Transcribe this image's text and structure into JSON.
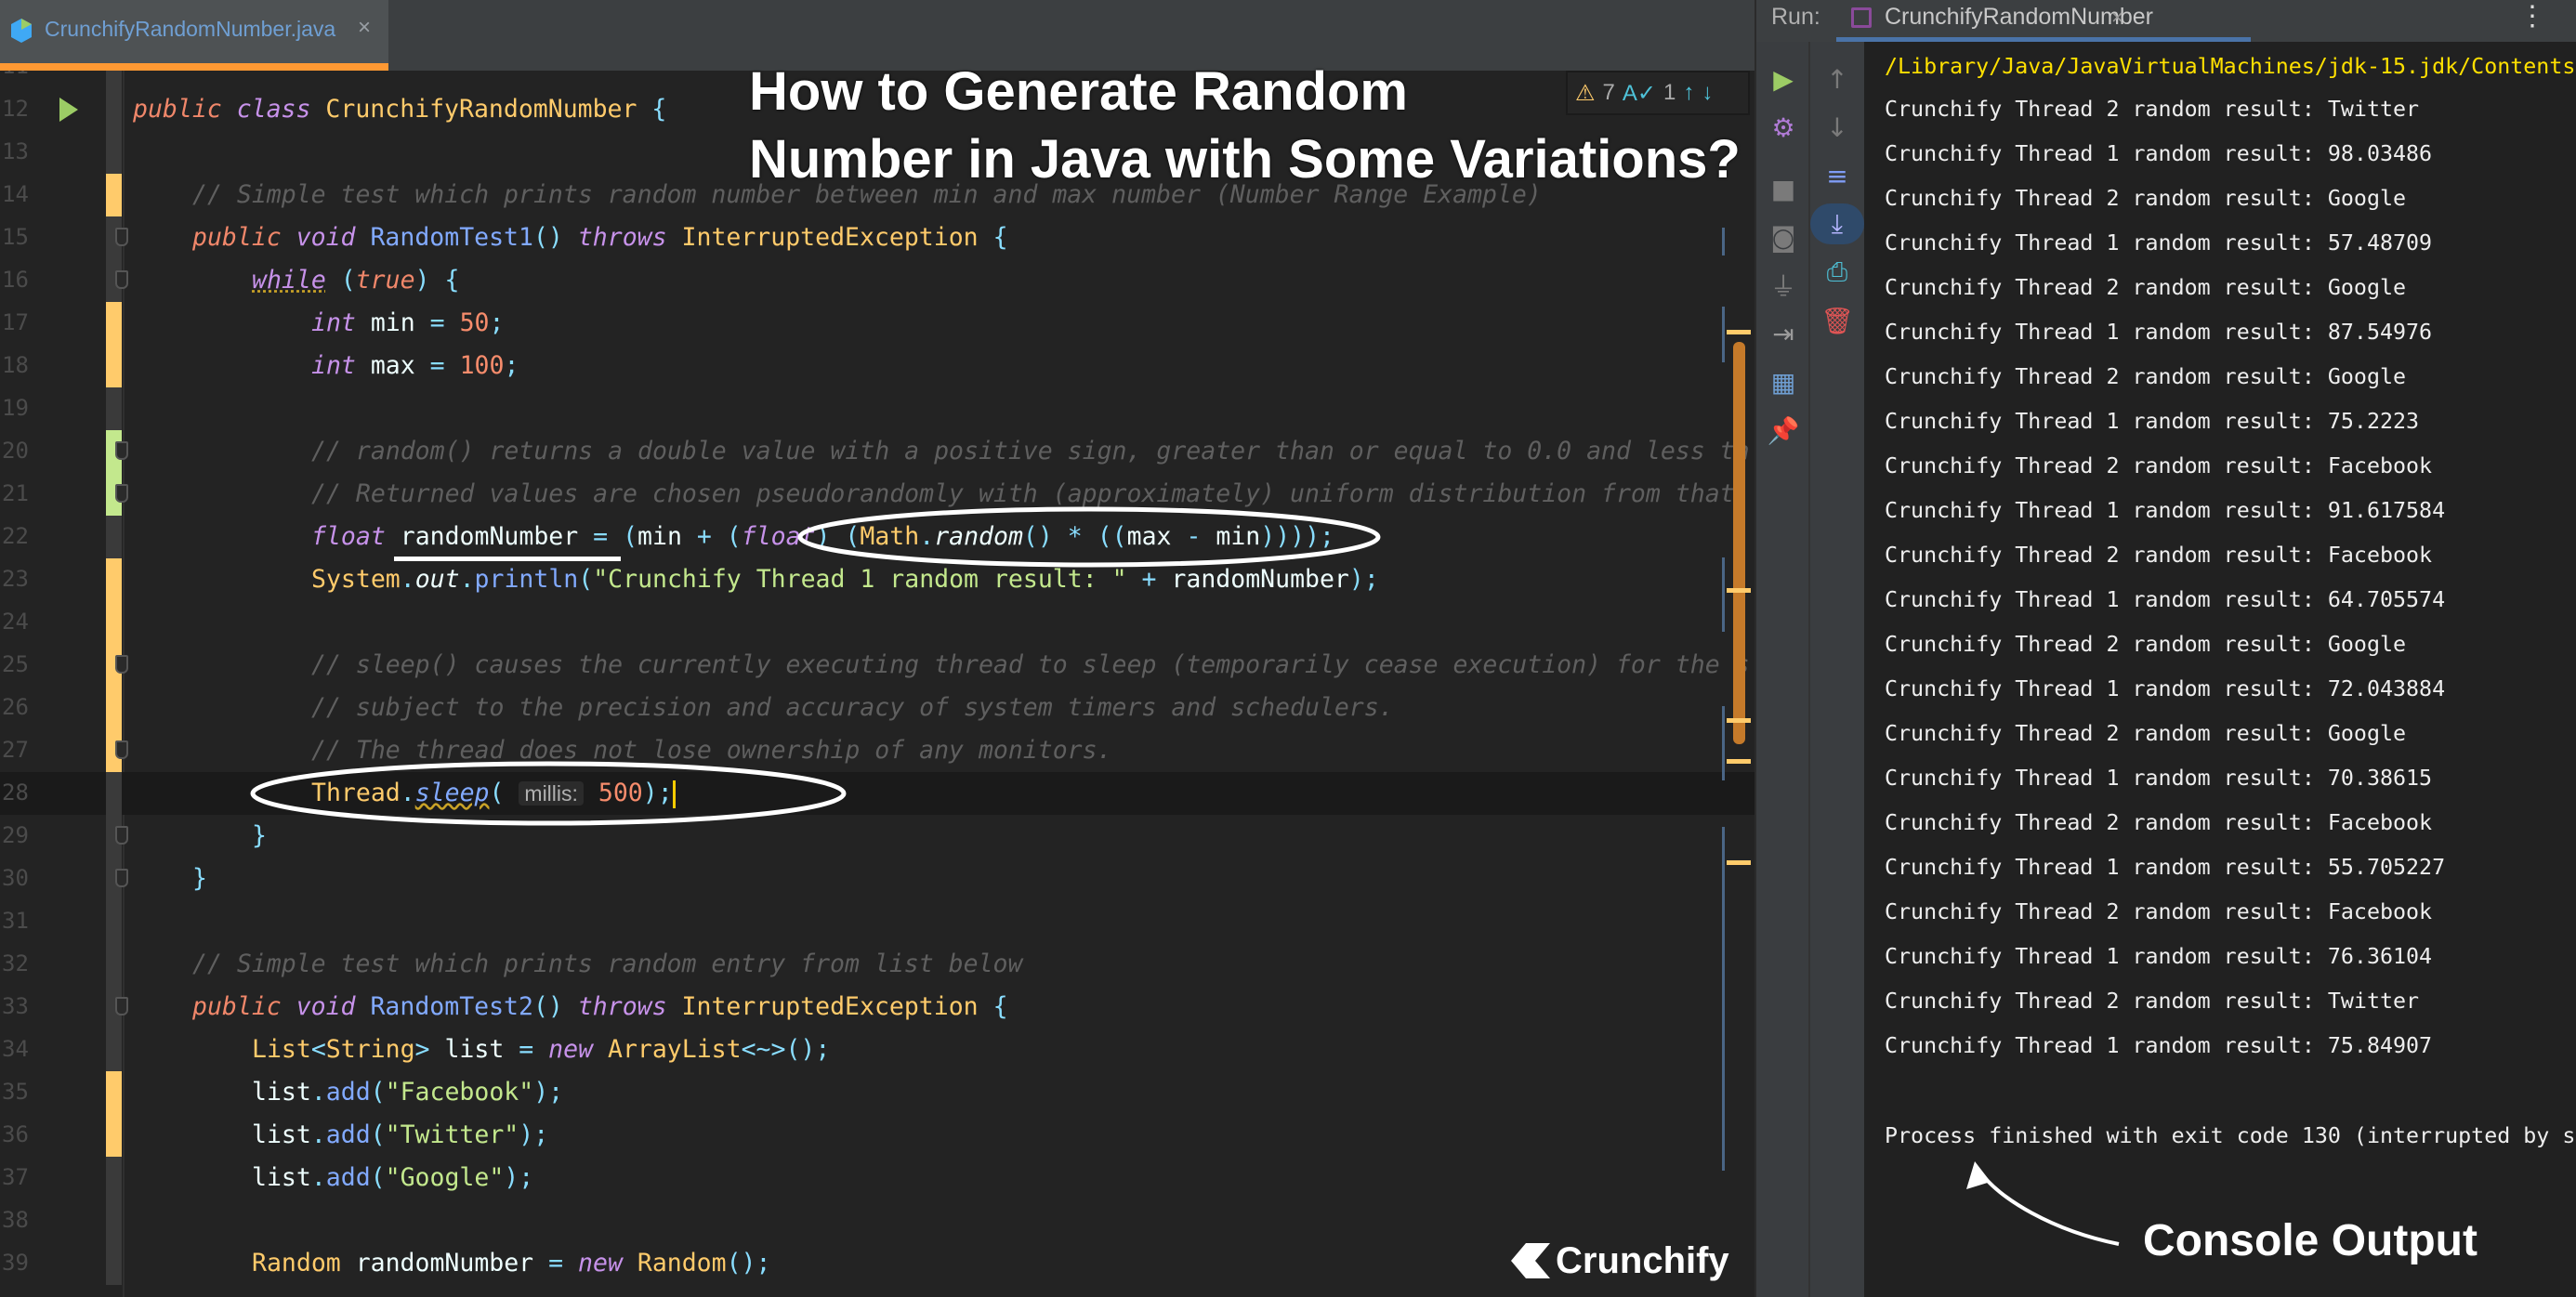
{
  "editor_tab": {
    "filename": "CrunchifyRandomNumber.java",
    "close": "×",
    "icon": "java-class-icon"
  },
  "overlay_title": {
    "line1": "How to Generate Random",
    "line2": "Number in Java with Some Variations?"
  },
  "inspection": {
    "warnings": "7",
    "typos": "1",
    "warn_icon": "⚠",
    "typo_icon": "A✓",
    "up": "↑",
    "down": "↓"
  },
  "editor": {
    "current_line": 28,
    "lines": [
      {
        "n": "11",
        "indent": 0,
        "change": "none",
        "tokens": []
      },
      {
        "n": "12",
        "indent": 0,
        "change": "none",
        "run": true,
        "tokens": [
          [
            "public ",
            "pub"
          ],
          [
            "class ",
            "kw"
          ],
          [
            "CrunchifyRandomNumber ",
            "cls"
          ],
          [
            "{",
            "p"
          ]
        ]
      },
      {
        "n": "13",
        "indent": 0,
        "change": "none",
        "tokens": []
      },
      {
        "n": "14",
        "indent": 1,
        "change": "modified",
        "tokens": [
          [
            "// Simple test which prints random number between min and max number (Number Range Example)",
            "cm"
          ]
        ]
      },
      {
        "n": "15",
        "indent": 1,
        "change": "none",
        "fold": true,
        "tokens": [
          [
            "public ",
            "pub"
          ],
          [
            "void ",
            "kw"
          ],
          [
            "RandomTest1",
            "fn"
          ],
          [
            "() ",
            "p"
          ],
          [
            "throws ",
            "kw"
          ],
          [
            "InterruptedException ",
            "cls"
          ],
          [
            "{",
            "p"
          ]
        ]
      },
      {
        "n": "16",
        "indent": 2,
        "change": "none",
        "fold": true,
        "tokens": [
          [
            "while",
            "kwu"
          ],
          [
            " (",
            "p"
          ],
          [
            "true",
            "pub"
          ],
          [
            ") {",
            "p"
          ]
        ]
      },
      {
        "n": "17",
        "indent": 3,
        "change": "modified",
        "tokens": [
          [
            "int ",
            "kw"
          ],
          [
            "min ",
            "id"
          ],
          [
            "= ",
            "p"
          ],
          [
            "50",
            "num"
          ],
          [
            ";",
            "p"
          ]
        ]
      },
      {
        "n": "18",
        "indent": 3,
        "change": "modified",
        "tokens": [
          [
            "int ",
            "kw"
          ],
          [
            "max ",
            "id"
          ],
          [
            "= ",
            "p"
          ],
          [
            "100",
            "num"
          ],
          [
            ";",
            "p"
          ]
        ]
      },
      {
        "n": "19",
        "indent": 0,
        "change": "none",
        "tokens": []
      },
      {
        "n": "20",
        "indent": 3,
        "change": "added",
        "fold": true,
        "tokens": [
          [
            "// random() returns a double value with a positive sign, greater than or equal to 0.0 and less th",
            "cm"
          ]
        ]
      },
      {
        "n": "21",
        "indent": 3,
        "change": "added",
        "fold": true,
        "tokens": [
          [
            "// Returned values are chosen pseudorandomly with (approximately) uniform distribution from that",
            "cm"
          ]
        ]
      },
      {
        "n": "22",
        "indent": 3,
        "change": "none",
        "tokens": [
          [
            "float ",
            "kw"
          ],
          [
            "randomNumber ",
            "id"
          ],
          [
            "= (",
            "p"
          ],
          [
            "min ",
            "id"
          ],
          [
            "+ (",
            "p"
          ],
          [
            "float",
            "kw"
          ],
          [
            ") (",
            "p"
          ],
          [
            "Math",
            "cls"
          ],
          [
            ".",
            "p"
          ],
          [
            "random",
            "fni0"
          ],
          [
            "() * ((",
            "p"
          ],
          [
            "max ",
            "id"
          ],
          [
            "- ",
            "p"
          ],
          [
            "min",
            "id"
          ],
          [
            "))));",
            "p"
          ]
        ]
      },
      {
        "n": "23",
        "indent": 3,
        "change": "modified",
        "tokens": [
          [
            "System",
            "cls"
          ],
          [
            ".",
            "p"
          ],
          [
            "out",
            "it"
          ],
          [
            ".",
            "p"
          ],
          [
            "println",
            "fn"
          ],
          [
            "(",
            "p"
          ],
          [
            "\"Crunchify Thread 1 random result: \" ",
            "str"
          ],
          [
            "+ ",
            "p"
          ],
          [
            "randomNumber",
            "id"
          ],
          [
            ");",
            "p"
          ]
        ]
      },
      {
        "n": "24",
        "indent": 0,
        "change": "modified",
        "tokens": []
      },
      {
        "n": "25",
        "indent": 3,
        "change": "modified",
        "fold": true,
        "tokens": [
          [
            "// sleep() causes the currently executing thread to sleep (temporarily cease execution) for the s",
            "cm"
          ]
        ]
      },
      {
        "n": "26",
        "indent": 3,
        "change": "modified",
        "tokens": [
          [
            "// subject to the precision and accuracy of system timers and schedulers.",
            "cm"
          ]
        ]
      },
      {
        "n": "27",
        "indent": 3,
        "change": "modified",
        "fold": true,
        "tokens": [
          [
            "// The thread does not lose ownership of any monitors.",
            "cm"
          ]
        ]
      },
      {
        "n": "28",
        "indent": 3,
        "change": "none",
        "tokens": [
          [
            "Thread",
            "cls"
          ],
          [
            ".",
            "p"
          ],
          [
            "sleep",
            "fni"
          ],
          [
            "( ",
            "p"
          ],
          [
            "millis:",
            "hint"
          ],
          [
            " ",
            "p"
          ],
          [
            "500",
            "num"
          ],
          [
            ");",
            "p"
          ]
        ],
        "caret": true
      },
      {
        "n": "29",
        "indent": 2,
        "change": "none",
        "fold": true,
        "tokens": [
          [
            "}",
            "p"
          ]
        ]
      },
      {
        "n": "30",
        "indent": 1,
        "change": "none",
        "fold": true,
        "tokens": [
          [
            "}",
            "p"
          ]
        ]
      },
      {
        "n": "31",
        "indent": 0,
        "change": "none",
        "tokens": []
      },
      {
        "n": "32",
        "indent": 1,
        "change": "none",
        "tokens": [
          [
            "// Simple test which prints random entry from list below",
            "cm"
          ]
        ]
      },
      {
        "n": "33",
        "indent": 1,
        "change": "none",
        "fold": true,
        "tokens": [
          [
            "public ",
            "pub"
          ],
          [
            "void ",
            "kw"
          ],
          [
            "RandomTest2",
            "fn"
          ],
          [
            "() ",
            "p"
          ],
          [
            "throws ",
            "kw"
          ],
          [
            "InterruptedException ",
            "cls"
          ],
          [
            "{",
            "p"
          ]
        ]
      },
      {
        "n": "34",
        "indent": 2,
        "change": "none",
        "tokens": [
          [
            "List",
            "cls"
          ],
          [
            "<",
            "p"
          ],
          [
            "String",
            "cls"
          ],
          [
            "> ",
            "p"
          ],
          [
            "list ",
            "id"
          ],
          [
            "= ",
            "p"
          ],
          [
            "new ",
            "kw"
          ],
          [
            "ArrayList",
            "cls"
          ],
          [
            "<~>();",
            "p"
          ]
        ]
      },
      {
        "n": "35",
        "indent": 2,
        "change": "modified",
        "tokens": [
          [
            "list",
            "id"
          ],
          [
            ".",
            "p"
          ],
          [
            "add",
            "fn"
          ],
          [
            "(",
            "p"
          ],
          [
            "\"Facebook\"",
            "str"
          ],
          [
            ");",
            "p"
          ]
        ]
      },
      {
        "n": "36",
        "indent": 2,
        "change": "modified",
        "tokens": [
          [
            "list",
            "id"
          ],
          [
            ".",
            "p"
          ],
          [
            "add",
            "fn"
          ],
          [
            "(",
            "p"
          ],
          [
            "\"Twitter\"",
            "str"
          ],
          [
            ");",
            "p"
          ]
        ]
      },
      {
        "n": "37",
        "indent": 2,
        "change": "none",
        "tokens": [
          [
            "list",
            "id"
          ],
          [
            ".",
            "p"
          ],
          [
            "add",
            "fn"
          ],
          [
            "(",
            "p"
          ],
          [
            "\"Google\"",
            "str"
          ],
          [
            ");",
            "p"
          ]
        ]
      },
      {
        "n": "38",
        "indent": 0,
        "change": "none",
        "tokens": []
      },
      {
        "n": "39",
        "indent": 2,
        "change": "none",
        "tokens": [
          [
            "Random ",
            "cls"
          ],
          [
            "randomNumber ",
            "id"
          ],
          [
            "= ",
            "p"
          ],
          [
            "new ",
            "kw"
          ],
          [
            "Random",
            "cls"
          ],
          [
            "();",
            "p"
          ]
        ]
      }
    ]
  },
  "logo": {
    "text": "Crunchify"
  },
  "run_panel": {
    "label": "Run:",
    "tab": "CrunchifyRandomNumber",
    "close": "×",
    "more": "⋮",
    "toolbar_left": [
      {
        "icon": "rerun-icon",
        "glyph": "▶",
        "color": "#9ccc65"
      },
      {
        "icon": "settings-icon",
        "glyph": "⚙",
        "color": "#b07bd6"
      },
      {
        "icon": "stop-icon",
        "glyph": "■",
        "color": "#7a7a7a"
      },
      {
        "icon": "camera-icon",
        "glyph": "◙",
        "color": "#7a7a7a"
      },
      {
        "icon": "plug-icon",
        "glyph": "⏚",
        "color": "#7a7a7a"
      },
      {
        "icon": "exit-icon",
        "glyph": "⇥",
        "color": "#9a9a9a"
      },
      {
        "icon": "layout-icon",
        "glyph": "▦",
        "color": "#6f9fd3"
      },
      {
        "icon": "pin-icon",
        "glyph": "📌",
        "color": "#b07bd6"
      }
    ],
    "toolbar_right": [
      {
        "icon": "up-icon",
        "glyph": "↑",
        "color": "#7a7a7a"
      },
      {
        "icon": "down-icon",
        "glyph": "↓",
        "color": "#7a7a7a"
      },
      {
        "icon": "soft-wrap-icon",
        "glyph": "≡",
        "color": "#7f9cf5"
      },
      {
        "icon": "scroll-to-end-icon",
        "glyph": "⤓",
        "color": "#b6b6ff"
      },
      {
        "icon": "print-icon",
        "glyph": "⎙",
        "color": "#4ec2d8"
      },
      {
        "icon": "trash-icon",
        "glyph": "🗑",
        "color": "#e05555"
      }
    ],
    "console": {
      "path": "/Library/Java/JavaVirtualMachines/jdk-15.jdk/Contents",
      "lines": [
        "Crunchify Thread 2 random result: Twitter",
        "Crunchify Thread 1 random result: 98.03486",
        "Crunchify Thread 2 random result: Google",
        "Crunchify Thread 1 random result: 57.48709",
        "Crunchify Thread 2 random result: Google",
        "Crunchify Thread 1 random result: 87.54976",
        "Crunchify Thread 2 random result: Google",
        "Crunchify Thread 1 random result: 75.2223",
        "Crunchify Thread 2 random result: Facebook",
        "Crunchify Thread 1 random result: 91.617584",
        "Crunchify Thread 2 random result: Facebook",
        "Crunchify Thread 1 random result: 64.705574",
        "Crunchify Thread 2 random result: Google",
        "Crunchify Thread 1 random result: 72.043884",
        "Crunchify Thread 2 random result: Google",
        "Crunchify Thread 1 random result: 70.38615",
        "Crunchify Thread 2 random result: Facebook",
        "Crunchify Thread 1 random result: 55.705227",
        "Crunchify Thread 2 random result: Facebook",
        "Crunchify Thread 1 random result: 76.36104",
        "Crunchify Thread 2 random result: Twitter",
        "Crunchify Thread 1 random result: 75.84907"
      ],
      "exit": "Process finished with exit code 130 (interrupted by s"
    }
  },
  "annotation": {
    "console_output": "Console Output"
  }
}
